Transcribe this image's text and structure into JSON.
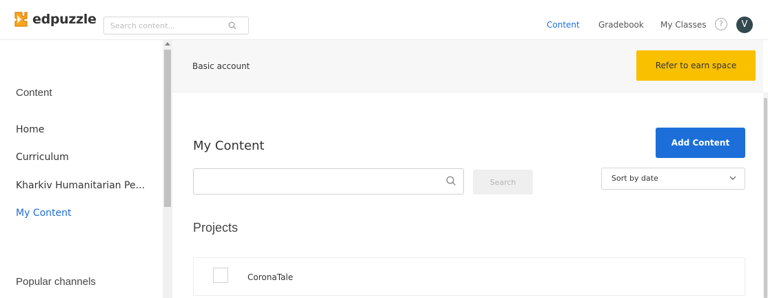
{
  "header": {
    "logo_text": "edpuzzle",
    "search_placeholder": "Search content...",
    "nav": [
      {
        "label": "Content",
        "active": true
      },
      {
        "label": "Gradebook",
        "active": false
      },
      {
        "label": "My Classes",
        "active": false
      }
    ],
    "help_symbol": "?",
    "avatar_letter": "V"
  },
  "sidebar": {
    "heading": "Content",
    "items": [
      {
        "label": "Home",
        "active": false
      },
      {
        "label": "Curriculum",
        "active": false
      },
      {
        "label": "Kharkiv Humanitarian Pe...",
        "active": false
      },
      {
        "label": "My Content",
        "active": true
      }
    ],
    "section2_heading": "Popular channels"
  },
  "banner": {
    "text": "Basic account",
    "refer_button": "Refer to earn space"
  },
  "main": {
    "title": "My Content",
    "add_button": "Add Content",
    "search_placeholder": "",
    "search_button": "Search",
    "sort_value": "Sort by date",
    "projects_heading": "Projects",
    "projects": [
      {
        "name": "CoronaTale"
      }
    ]
  },
  "colors": {
    "accent_blue": "#1c6fd8",
    "refer_yellow": "#f9c000",
    "avatar_bg": "#32494f"
  }
}
